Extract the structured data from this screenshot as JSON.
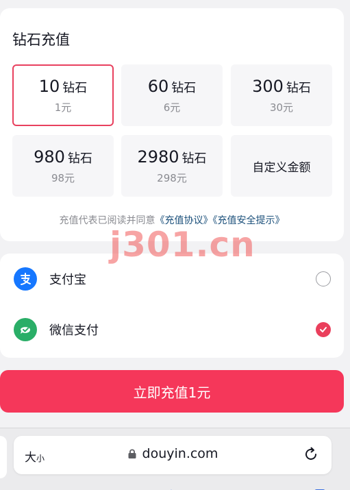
{
  "recharge": {
    "title": "钻石充值",
    "options": [
      {
        "amount": "10",
        "unit": "钻石",
        "price": "1元",
        "selected": true
      },
      {
        "amount": "60",
        "unit": "钻石",
        "price": "6元"
      },
      {
        "amount": "300",
        "unit": "钻石",
        "price": "30元"
      },
      {
        "amount": "980",
        "unit": "钻石",
        "price": "98元"
      },
      {
        "amount": "2980",
        "unit": "钻石",
        "price": "298元"
      }
    ],
    "custom_label": "自定义金额",
    "agreement_prefix": "充值代表已阅读并同意",
    "agreement_link1": "《充值协议》",
    "agreement_link2": "《充值安全提示》"
  },
  "watermark": "j301.cn",
  "payment": {
    "methods": [
      {
        "label": "支付宝",
        "icon": "alipay-icon",
        "selected": false
      },
      {
        "label": "微信支付",
        "icon": "wechat-pay-icon",
        "selected": true
      }
    ]
  },
  "submit_label": "立即充值1元",
  "browser": {
    "text_size_label": "大",
    "text_size_small": "小",
    "url": "douyin.com"
  },
  "colors": {
    "accent": "#f5375a",
    "selected_border": "#e8405e",
    "link": "#1a4f7a",
    "alipay": "#1677ff",
    "wechat": "#2aae67"
  }
}
